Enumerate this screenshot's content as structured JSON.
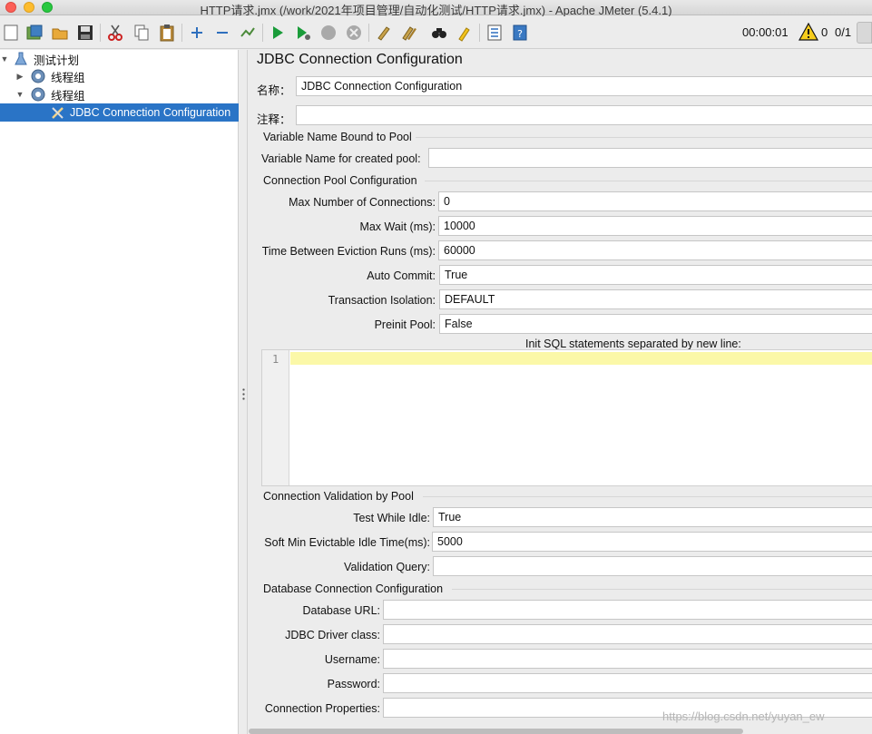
{
  "window": {
    "title": "HTTP请求.jmx (/work/2021年项目管理/自动化测试/HTTP请求.jmx) - Apache JMeter (5.4.1)"
  },
  "toolbar": {
    "timer": "00:00:01",
    "warnings": "0",
    "threads": "0/1"
  },
  "tree": {
    "root": "测试计划",
    "items": [
      "线程组",
      "线程组",
      "JDBC Connection Configuration"
    ]
  },
  "panel": {
    "title": "JDBC Connection Configuration",
    "name_label": "名称：",
    "name_value": "JDBC Connection Configuration",
    "comment_label": "注释：",
    "comment_value": "",
    "sections": {
      "variable": "Variable Name Bound to Pool",
      "pool": "Connection Pool Configuration",
      "validation": "Connection Validation by Pool",
      "database": "Database Connection Configuration"
    },
    "variable_name": {
      "label": "Variable Name for created pool:",
      "value": ""
    },
    "pool_fields": [
      {
        "label": "Max Number of Connections:",
        "value": "0"
      },
      {
        "label": "Max Wait (ms):",
        "value": "10000"
      },
      {
        "label": "Time Between Eviction Runs (ms):",
        "value": "60000"
      },
      {
        "label": "Auto Commit:",
        "value": "True"
      },
      {
        "label": "Transaction Isolation:",
        "value": "DEFAULT"
      },
      {
        "label": "Preinit Pool:",
        "value": "False"
      }
    ],
    "init_sql_label": "Init SQL statements separated by new line:",
    "init_sql_line": "1",
    "validation_fields": [
      {
        "label": "Test While Idle:",
        "value": "True"
      },
      {
        "label": "Soft Min Evictable Idle Time(ms):",
        "value": "5000"
      },
      {
        "label": "Validation Query:",
        "value": ""
      }
    ],
    "db_fields": [
      {
        "label": "Database URL:",
        "value": ""
      },
      {
        "label": "JDBC Driver class:",
        "value": ""
      },
      {
        "label": "Username:",
        "value": ""
      },
      {
        "label": "Password:",
        "value": ""
      },
      {
        "label": "Connection Properties:",
        "value": ""
      }
    ]
  },
  "watermark": "https://blog.csdn.net/yuyan_ew"
}
